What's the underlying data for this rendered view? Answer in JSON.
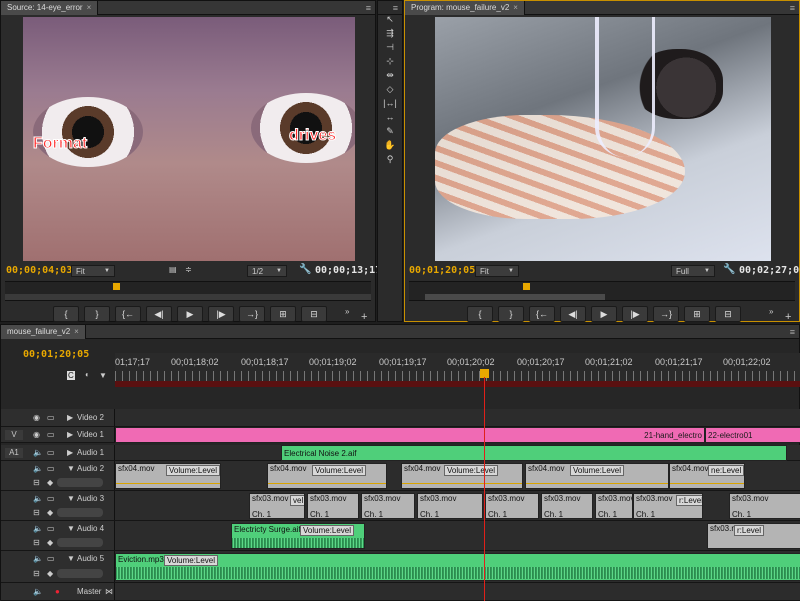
{
  "source": {
    "tab": "Source: 14-eye_error",
    "caption_left": "Format",
    "caption_right": "drives",
    "timecode": "00;00;04;03",
    "zoom": "Fit",
    "resolution": "1/2",
    "duration": "00;00;13;17"
  },
  "program": {
    "tab": "Program: mouse_failure_v2",
    "timecode": "00;01;20;05",
    "zoom": "Fit",
    "resolution": "Full",
    "duration": "00;02;27;00"
  },
  "timeline": {
    "tab": "mouse_failure_v2",
    "timecode": "00;01;20;05",
    "ruler": [
      "01;17;17",
      "00;01;18;02",
      "00;01;18;17",
      "00;01;19;02",
      "00;01;19;17",
      "00;01;20;02",
      "00;01;20;17",
      "00;01;21;02",
      "00;01;21;17",
      "00;01;22;02"
    ],
    "tracks": {
      "video2": "Video 2",
      "video1": "Video 1",
      "audio1": "Audio 1",
      "audio2": "Audio 2",
      "audio3": "Audio 3",
      "audio4": "Audio 4",
      "audio5": "Audio 5",
      "master": "Master",
      "v_target": "V",
      "a_target": "A1"
    },
    "clips": {
      "v1_a": "21-hand_electro",
      "v1_b": "22-electro01",
      "a1": "Electrical Noise 2.aif",
      "sfx04": "sfx04.mov",
      "sfx03": "sfx03.mov",
      "vol": "Volume:Level",
      "vol_short": "vel",
      "vol_short2": "r:Level",
      "vol_short3": "ne:Level",
      "ch1": "Ch. 1",
      "a4": "Electricty Surge.aif",
      "a5": "Eviction.mp3"
    }
  },
  "colors": {
    "accent_timecode": "#e8a800",
    "video_clip": "#f06ab4",
    "audio_clip_green": "#4fcf7a",
    "playhead": "#e0201a"
  }
}
